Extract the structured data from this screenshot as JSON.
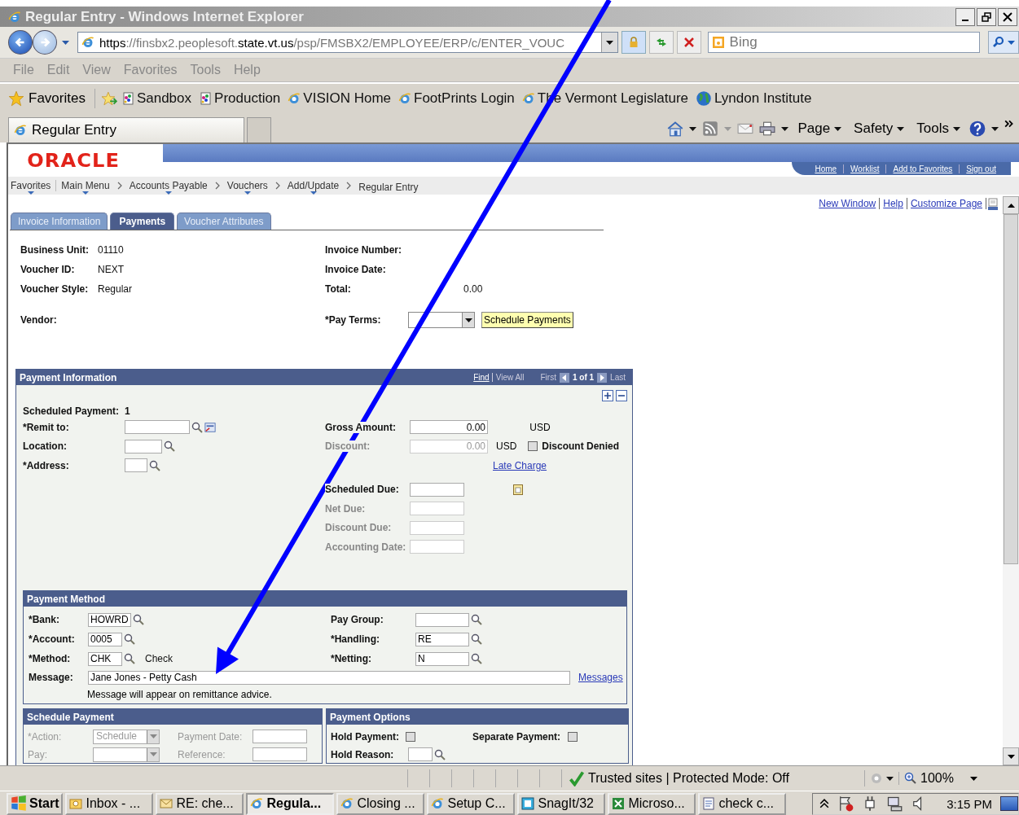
{
  "window": {
    "title": "Regular Entry - Windows Internet Explorer"
  },
  "address_bar": {
    "url_parts": [
      {
        "text": "https",
        "strong": true
      },
      {
        "text": "://finsbx2.peoplesoft.",
        "strong": false
      },
      {
        "text": "state.vt.us",
        "strong": true
      },
      {
        "text": "/psp/FMSBX2/EMPLOYEE/ERP/c/ENTER_VOUC",
        "strong": false
      }
    ],
    "search_placeholder": "Bing"
  },
  "menu_bar": [
    "File",
    "Edit",
    "View",
    "Favorites",
    "Tools",
    "Help"
  ],
  "favorites_bar": {
    "label": "Favorites",
    "links": [
      {
        "label": "Sandbox",
        "kind": "app"
      },
      {
        "label": "Production",
        "kind": "app"
      },
      {
        "label": "VISION Home",
        "kind": "ie"
      },
      {
        "label": "FootPrints Login",
        "kind": "ie"
      },
      {
        "label": "The Vermont Legislature",
        "kind": "ie"
      },
      {
        "label": "Lyndon Institute",
        "kind": "globe"
      }
    ]
  },
  "browser_tab": {
    "title": "Regular Entry"
  },
  "command_bar": [
    "Page",
    "Safety",
    "Tools"
  ],
  "page": {
    "logo": "ORACLE",
    "header_links": [
      "Home",
      "Worklist",
      "Add to Favorites",
      "Sign out"
    ],
    "breadcrumbs": [
      {
        "label": "Favorites",
        "menu": true
      },
      {
        "label": "Main Menu",
        "menu": true
      },
      {
        "label": "Accounts Payable",
        "menu": true
      },
      {
        "label": "Vouchers",
        "menu": true
      },
      {
        "label": "Add/Update",
        "menu": true
      },
      {
        "label": "Regular Entry",
        "menu": false
      }
    ],
    "page_links": [
      "New Window",
      "Help",
      "Customize Page"
    ],
    "tabs": [
      {
        "label": "Invoice Information",
        "selected": false
      },
      {
        "label": "Payments",
        "selected": true
      },
      {
        "label": "Voucher Attributes",
        "selected": false
      }
    ],
    "summary_left": [
      {
        "label": "Business Unit:",
        "value": "01110"
      },
      {
        "label": "Voucher ID:",
        "value": "NEXT"
      },
      {
        "label": "Voucher Style:",
        "value": "Regular"
      }
    ],
    "summary_right": [
      {
        "label": "Invoice Number:"
      },
      {
        "label": "Invoice Date:"
      },
      {
        "label": "Total:",
        "value": "0.00"
      }
    ],
    "vendor_label": "Vendor:",
    "pay_terms_label": "*Pay Terms:",
    "schedule_button": "Schedule Payments",
    "payment_information": {
      "title": "Payment Information",
      "find": "Find",
      "view_all": "View All",
      "first": "First",
      "count": "1 of 1",
      "last": "Last",
      "scheduled_label": "Scheduled Payment:",
      "scheduled_value": "1",
      "left_fields": [
        {
          "label": "*Remit to:"
        },
        {
          "label": "Location:"
        },
        {
          "label": "*Address:"
        }
      ],
      "amounts": [
        {
          "label": "Gross Amount:",
          "value": "0.00",
          "unit": "USD",
          "disabled": false
        },
        {
          "label": "Discount:",
          "value": "0.00",
          "unit": "USD",
          "disabled": true
        }
      ],
      "discount_denied": {
        "label": "Discount Denied",
        "checked": false
      },
      "late_charge": "Late Charge",
      "dates": [
        {
          "label": "Scheduled Due:",
          "disabled": false
        },
        {
          "label": "Net Due:",
          "disabled": true
        },
        {
          "label": "Discount Due:",
          "disabled": true
        },
        {
          "label": "Accounting Date:",
          "disabled": true
        }
      ]
    },
    "payment_method": {
      "title": "Payment Method",
      "left": [
        {
          "label": "*Bank:",
          "value": "HOWRD"
        },
        {
          "label": "*Account:",
          "value": "0005"
        },
        {
          "label": "*Method:",
          "value": "CHK",
          "description": "Check"
        }
      ],
      "right": [
        {
          "label": "Pay Group:"
        },
        {
          "label": "*Handling:",
          "value": "RE"
        },
        {
          "label": "*Netting:",
          "value": "N"
        }
      ],
      "message_label": "Message:",
      "message_value": "Jane Jones - Petty Cash",
      "messages_link": "Messages",
      "note": "Message will appear on remittance advice."
    },
    "schedule_payment": {
      "title": "Schedule Payment",
      "rows": [
        {
          "label": "*Action:",
          "value": "Schedule",
          "date_label": "Payment Date:"
        },
        {
          "label": "Pay:",
          "date_label": "Reference:"
        }
      ]
    },
    "payment_options": {
      "title": "Payment Options",
      "hold_payment": {
        "label": "Hold Payment:",
        "checked": false
      },
      "separate_payment": {
        "label": "Separate Payment:",
        "checked": false
      },
      "hold_reason_label": "Hold Reason:"
    }
  },
  "status_bar": {
    "zone": "Trusted sites | Protected Mode: Off",
    "zoom": "100%"
  },
  "taskbar": {
    "start": "Start",
    "items": [
      {
        "label": "Inbox - ...",
        "selected": false
      },
      {
        "label": "RE: che...",
        "selected": false
      },
      {
        "label": "Regula...",
        "selected": true
      },
      {
        "label": "Closing ...",
        "selected": false
      },
      {
        "label": "Setup C...",
        "selected": false
      },
      {
        "label": "SnagIt/32",
        "selected": false
      },
      {
        "label": "Microso...",
        "selected": false
      },
      {
        "label": "check c...",
        "selected": false
      }
    ],
    "clock": "3:15 PM"
  }
}
